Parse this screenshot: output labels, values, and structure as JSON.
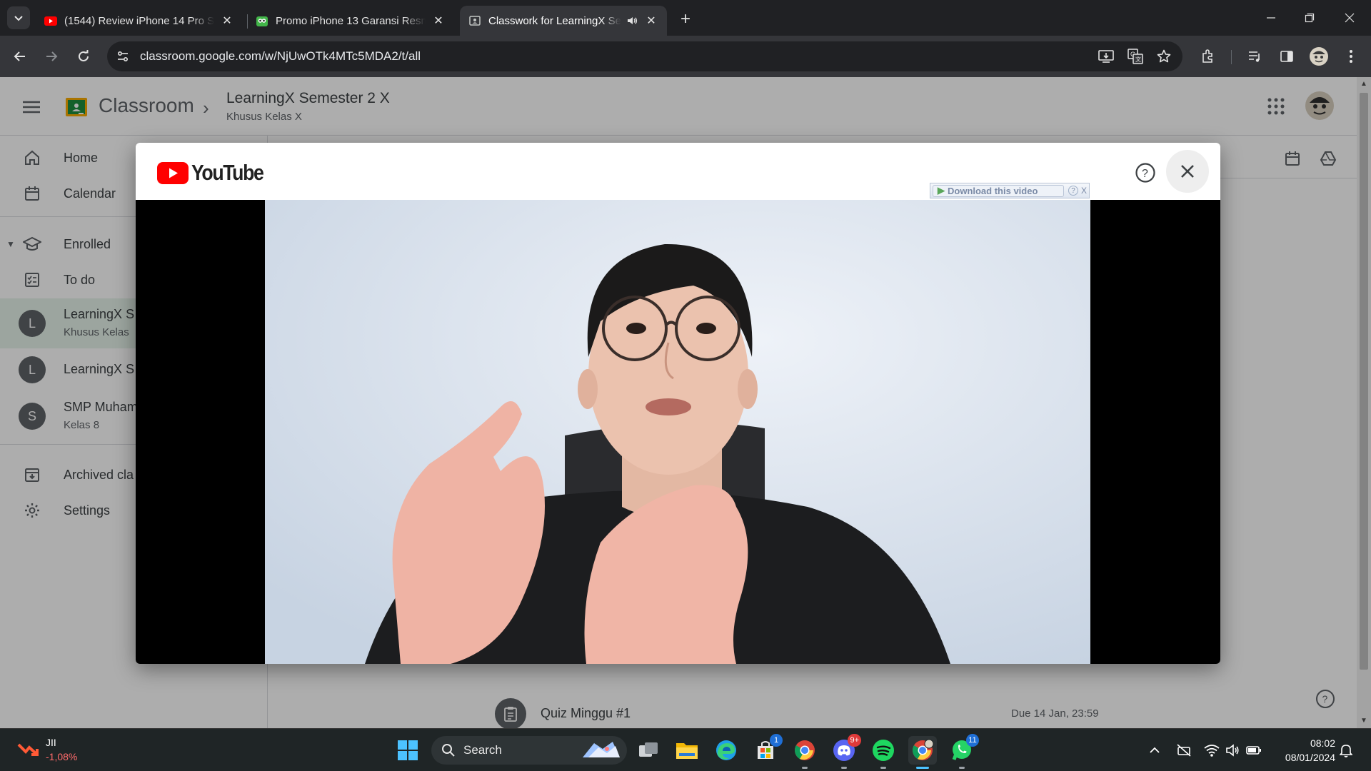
{
  "browser": {
    "tabs": [
      {
        "title": "(1544) Review iPhone 14 Pro Se",
        "favicon": "youtube-icon",
        "active": false
      },
      {
        "title": "Promo iPhone 13 Garansi Resmi",
        "favicon": "tokopedia-icon",
        "active": false
      },
      {
        "title": "Classwork for LearningX Sem",
        "favicon": "classroom-icon",
        "active": true
      }
    ],
    "url": "classroom.google.com/w/NjUwOTk4MTc5MDA2/t/all"
  },
  "classroom": {
    "brand": "Classroom",
    "class_title": "LearningX Semester 2 X",
    "class_subtitle": "Khusus Kelas X",
    "sidebar": {
      "home": "Home",
      "calendar": "Calendar",
      "enrolled": "Enrolled",
      "todo": "To do",
      "classes": [
        {
          "initial": "L",
          "name": "LearningX S",
          "sub": "Khusus Kelas"
        },
        {
          "initial": "L",
          "name": "LearningX S",
          "sub": ""
        },
        {
          "initial": "S",
          "name": "SMP Muham",
          "sub": "Kelas 8"
        }
      ],
      "archived": "Archived cla",
      "settings": "Settings"
    },
    "quiz": {
      "title": "Quiz Minggu #1",
      "due": "Due 14 Jan, 23:59"
    }
  },
  "modal": {
    "logo_text": "YouTube",
    "download_label": "Download this video",
    "download_help": "?",
    "download_close": "X"
  },
  "taskbar": {
    "ticker_name": "JII",
    "ticker_value": "-1,08%",
    "search_label": "Search",
    "store_badge": "1",
    "discord_badge": "9+",
    "whatsapp_badge": "11",
    "time": "08:02",
    "date": "08/01/2024"
  },
  "colors": {
    "youtube_red": "#ff0000",
    "classroom_green": "#1e8e3e",
    "accent_blue": "#4cc2ff"
  }
}
